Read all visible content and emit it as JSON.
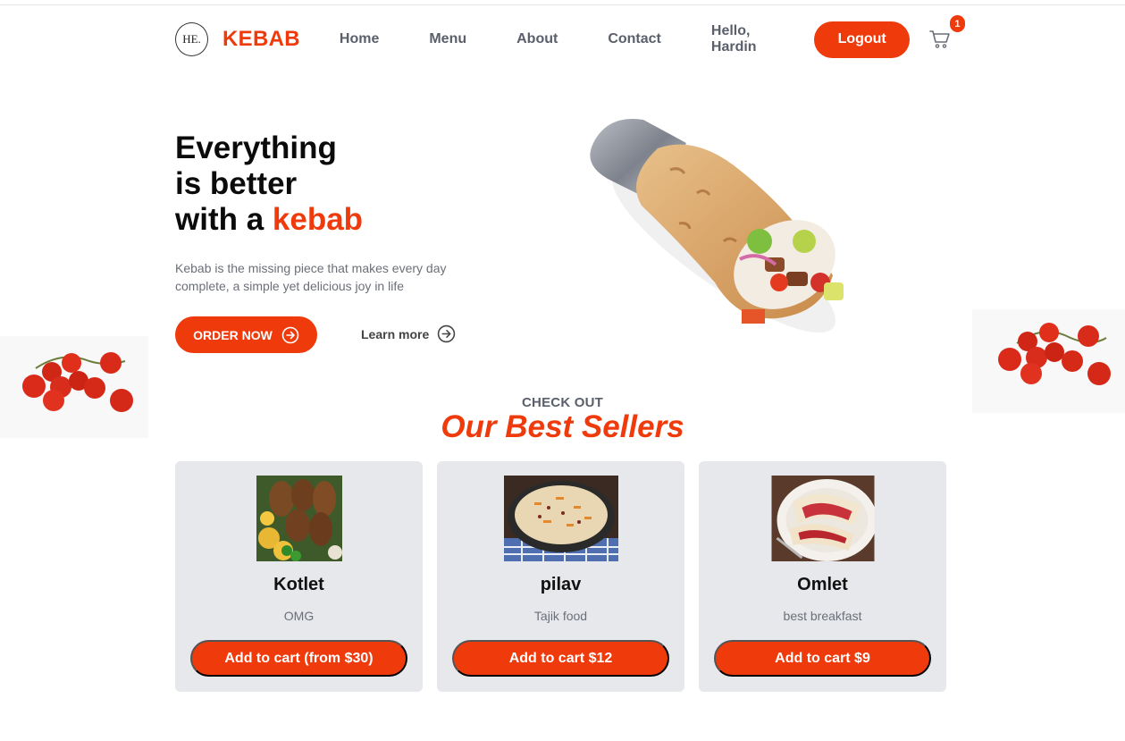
{
  "brand": {
    "logo_text": "HE.",
    "name": "KEBAB"
  },
  "nav": {
    "items": [
      {
        "label": "Home"
      },
      {
        "label": "Menu"
      },
      {
        "label": "About"
      },
      {
        "label": "Contact"
      }
    ],
    "greeting": "Hello, Hardin",
    "logout_label": "Logout",
    "cart_icon": "cart-icon",
    "cart_count": "1"
  },
  "hero": {
    "title_line1": "Everything",
    "title_line2": "is better",
    "title_line3_prefix": "with a ",
    "title_line3_accent": "kebab",
    "description": "Kebab is the missing piece that makes every day complete, a simple yet delicious joy in life",
    "order_label": "ORDER NOW",
    "learn_more_label": "Learn more",
    "arrow_icon": "arrow-circle-right-icon"
  },
  "section": {
    "eyebrow": "CHECK OUT",
    "title": "Our Best Sellers"
  },
  "products": [
    {
      "name": "Kotlet",
      "description": "OMG",
      "button_label": "Add to cart (from $30)"
    },
    {
      "name": "pilav",
      "description": "Tajik food",
      "button_label": "Add to cart $12"
    },
    {
      "name": "Omlet",
      "description": "best breakfast",
      "button_label": "Add to cart $9"
    }
  ],
  "colors": {
    "accent": "#ef3a0c",
    "card_bg": "#e7e8ec",
    "nav_text": "#5a5f6b",
    "muted_text": "#6b6f78"
  }
}
